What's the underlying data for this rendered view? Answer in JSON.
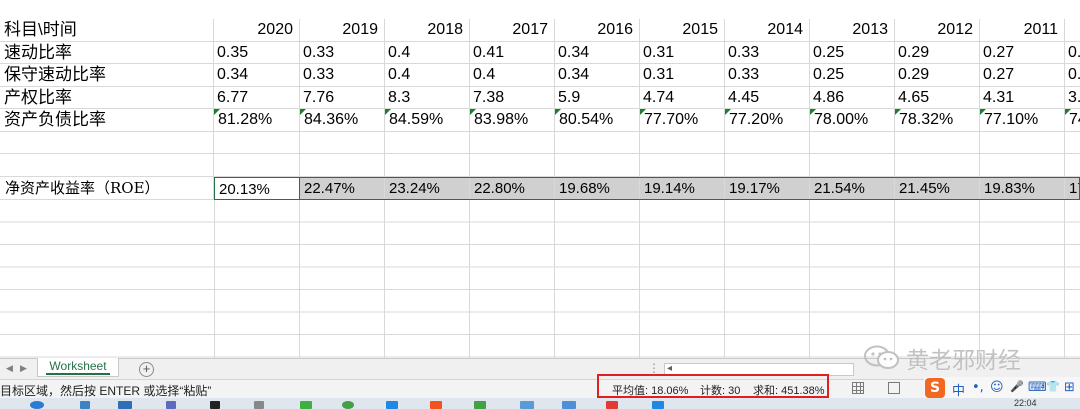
{
  "sheet": {
    "header_label": "科目\\时间",
    "years": [
      "2020",
      "2019",
      "2018",
      "2017",
      "2016",
      "2015",
      "2014",
      "2013",
      "2012",
      "2011",
      ""
    ],
    "rows": [
      {
        "label": "速动比率",
        "values": [
          "0.35",
          "0.33",
          "0.4",
          "0.41",
          "0.34",
          "0.31",
          "0.33",
          "0.25",
          "0.29",
          "0.27",
          "0."
        ]
      },
      {
        "label": "保守速动比率",
        "values": [
          "0.34",
          "0.33",
          "0.4",
          "0.4",
          "0.34",
          "0.31",
          "0.33",
          "0.25",
          "0.29",
          "0.27",
          "0."
        ]
      },
      {
        "label": "产权比率",
        "values": [
          "6.77",
          "7.76",
          "8.3",
          "7.38",
          "5.9",
          "4.74",
          "4.45",
          "4.86",
          "4.65",
          "4.31",
          "3."
        ]
      },
      {
        "label": "资产负债比率",
        "values": [
          "81.28%",
          "84.36%",
          "84.59%",
          "83.98%",
          "80.54%",
          "77.70%",
          "77.20%",
          "78.00%",
          "78.32%",
          "77.10%",
          "74"
        ]
      }
    ],
    "roe": {
      "label": "净资产收益率（ROE）",
      "values": [
        "20.13%",
        "22.47%",
        "23.24%",
        "22.80%",
        "19.68%",
        "19.14%",
        "19.17%",
        "21.54%",
        "21.45%",
        "19.83%",
        "17"
      ]
    }
  },
  "tabs": {
    "sheet_name": "Worksheet",
    "add_label": "+"
  },
  "status": {
    "message": "目标区域，然后按 ENTER 或选择“粘贴”",
    "average": "平均值: 18.06%",
    "count": "计数: 30",
    "sum": "求和: 451.38%"
  },
  "ime": {
    "logo": "S",
    "mode": "中",
    "items": [
      "•,",
      "☺",
      "🎤",
      "⌨",
      "👕",
      "⊞"
    ]
  },
  "watermark": {
    "text": "黄老邪财经"
  },
  "taskbar": {
    "clock": "22:04"
  },
  "colors": {
    "accent": "#217346",
    "highlight_box": "#e02020",
    "ime_logo": "#f26722"
  }
}
